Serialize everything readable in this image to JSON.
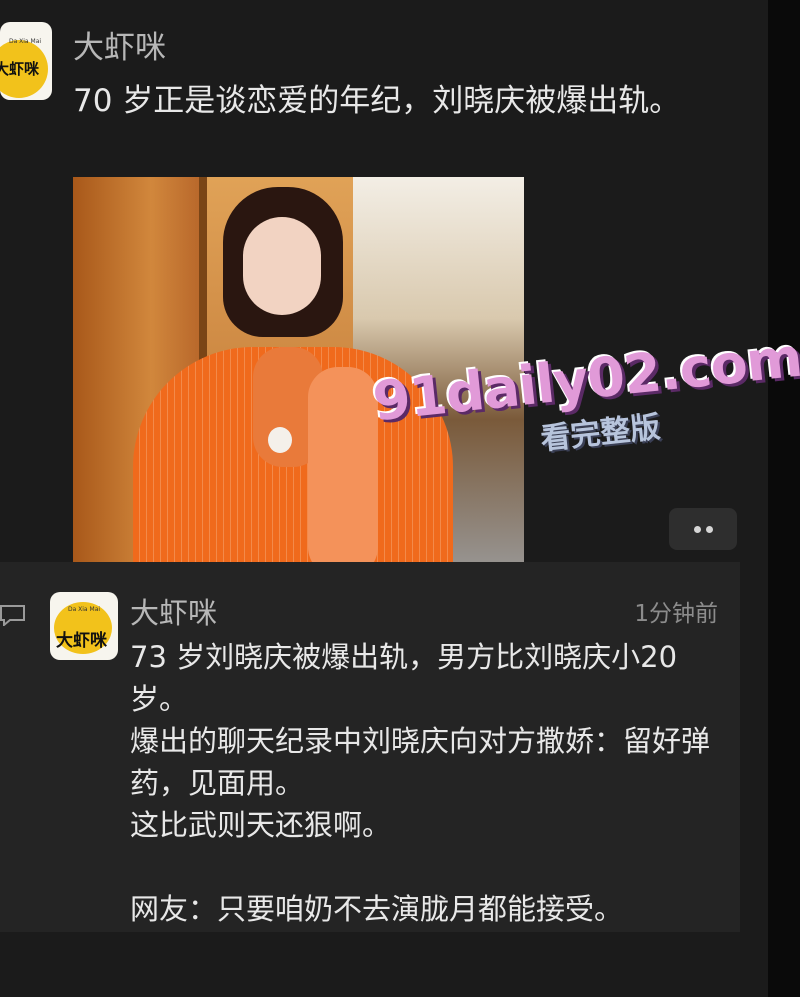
{
  "post": {
    "author": "大虾咪",
    "text": "70 岁正是谈恋爱的年纪，刘晓庆被爆出轨。",
    "avatar": {
      "logo_cn": "大虾咪",
      "logo_en": "Da Xia Mai"
    }
  },
  "watermark": {
    "site": "91daily02.com",
    "cta": "看完整版"
  },
  "more_button": {
    "icon": "ellipsis-icon"
  },
  "comment": {
    "author": "大虾咪",
    "time": "1分钟前",
    "avatar": {
      "logo_cn": "大虾咪",
      "logo_en": "Da Xia Mai"
    },
    "lines": [
      "73 岁刘晓庆被爆出轨，男方比刘晓庆小20 岁。",
      "爆出的聊天纪录中刘晓庆向对方撒娇：留好弹药，见面用。",
      "这比武则天还狠啊。",
      "",
      "网友：只要咱奶不去演胧月都能接受。"
    ]
  },
  "icons": {
    "comment_icon": "comment-icon"
  },
  "colors": {
    "background": "#1b1b1b",
    "panel": "#242424",
    "logo_yellow": "#f2c21b"
  }
}
